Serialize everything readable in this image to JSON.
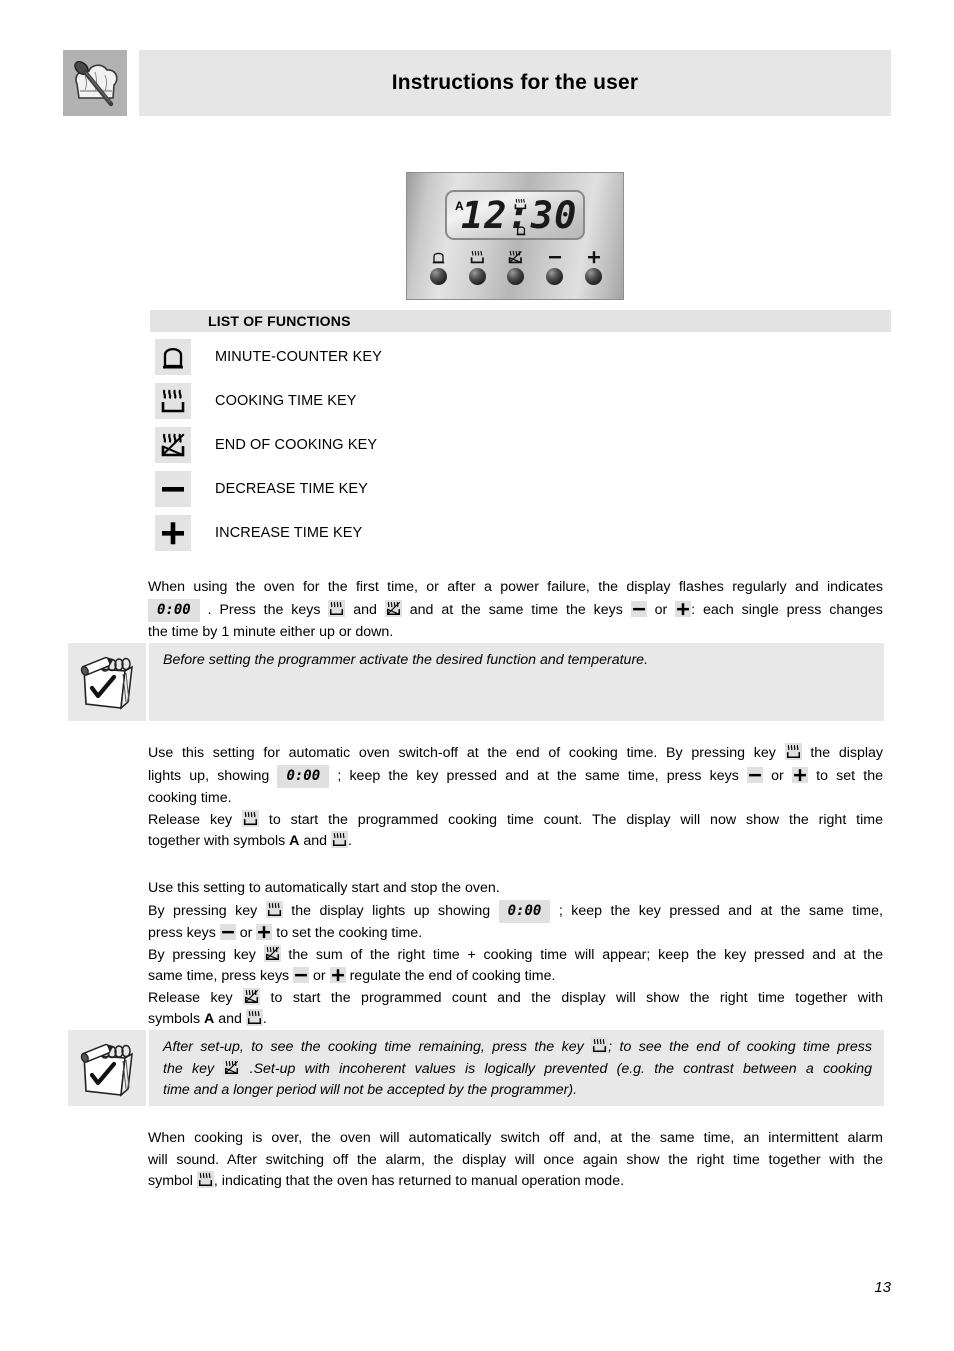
{
  "header": {
    "title": "Instructions for the user",
    "icon": "chef-hat-spoon-icon"
  },
  "programmer": {
    "display_time": "12:30",
    "auto_indicator": "A",
    "top_symbol": "cooking-icon",
    "bottom_symbol": "bell-icon",
    "buttons": [
      {
        "name": "minute-counter-button",
        "icon": "bell-icon"
      },
      {
        "name": "cooking-time-button",
        "icon": "cooking-icon"
      },
      {
        "name": "end-of-cooking-button",
        "icon": "end-of-cooking-icon"
      },
      {
        "name": "decrease-time-button",
        "icon": "minus-icon"
      },
      {
        "name": "increase-time-button",
        "icon": "plus-icon"
      }
    ]
  },
  "list_of_functions": {
    "heading": "LIST OF FUNCTIONS",
    "items": [
      {
        "icon": "bell-icon",
        "label": "MINUTE-COUNTER KEY"
      },
      {
        "icon": "cooking-icon",
        "label": "COOKING TIME KEY"
      },
      {
        "icon": "end-of-cooking-icon",
        "label": "END OF COOKING KEY"
      },
      {
        "icon": "minus-icon",
        "label": "DECREASE TIME KEY"
      },
      {
        "icon": "plus-icon",
        "label": "INCREASE TIME KEY"
      }
    ]
  },
  "intro": {
    "line1": "When using the oven for the first time, or after a power failure, the display flashes regularly and indicates",
    "zero_display": "0:00",
    "line2a": ". Press the keys",
    "line2b": "and",
    "line2c": "and at the same time the keys",
    "line2d": "or",
    "line2e": ": each single press changes",
    "line3": "the time by 1 minute either up or down."
  },
  "note1": {
    "text": "Before setting the programmer activate the desired function and temperature.",
    "icon": "notepad-pencil-icon"
  },
  "section_cooking_time": {
    "line1a": "Use this setting for automatic oven switch-off at the end of cooking time. By pressing key",
    "line1b": "the display",
    "line2a": "lights up, showing",
    "zero_display": "0:00",
    "line2b": "; keep the key pressed and at the same time, press keys",
    "line2c": "or",
    "line2d": "to set the",
    "line3": "cooking time.",
    "line4a": "Release key",
    "line4b": "to start the programmed cooking time count. The display will now show the right time",
    "line5a": "together with symbols",
    "line5_symbol_a": "A",
    "line5b": "and",
    "line5c": "."
  },
  "section_start_stop": {
    "line1": "Use this setting to automatically start and stop the oven.",
    "line2a": "By pressing key",
    "line2b": "the display lights up showing",
    "zero_display": "0:00",
    "line2c": "; keep the key pressed and at the same time,",
    "line3a": "press keys",
    "line3b": "or",
    "line3c": "to set the cooking time.",
    "line4a": "By pressing key",
    "line4b": "the sum of the right time + cooking time will appear; keep the key pressed and at the",
    "line5a": "same time, press keys",
    "line5b": "or",
    "line5c": "regulate the end of cooking time.",
    "line6a": "Release key",
    "line6b": "to start the programmed count and the display will show the right time together with",
    "line7a": "symbols",
    "line7_symbol_a": "A",
    "line7b": "and",
    "line7c": "."
  },
  "note2": {
    "icon": "notepad-pencil-icon",
    "line1a": "After set-up, to see the cooking time remaining, press the key",
    "line1b": "; to see the end of cooking time press",
    "line2a": "the key",
    "line2b": ".Set-up with incoherent values is logically prevented (e.g. the contrast between a cooking",
    "line3": "time and a longer period will not be accepted by the programmer)."
  },
  "section_end": {
    "line1": "When cooking is over, the oven will automatically switch off and, at the same time, an intermittent alarm",
    "line2": "will sound. After switching off the alarm, the display will once again show the right time together with the",
    "line3a": "symbol",
    "line3b": ", indicating that the oven has returned to manual operation mode."
  },
  "page_number": "13",
  "colors": {
    "header_band": "#e6e6e6",
    "icon_panel": "#b2b2b2",
    "note_bg": "#e8e8e8",
    "chip_bg": "#e0e0e0",
    "text": "#000000"
  }
}
